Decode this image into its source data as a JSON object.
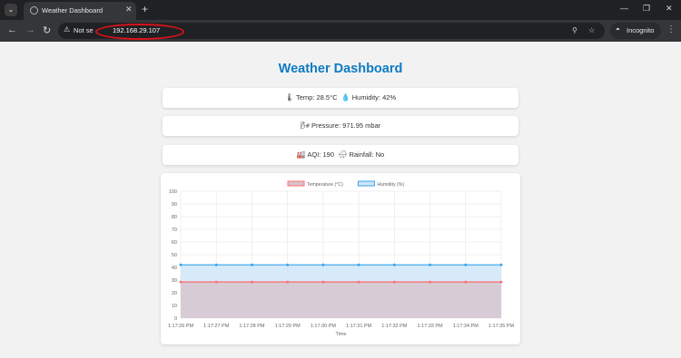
{
  "browser": {
    "tab_title": "Weather Dashboard",
    "omnibox": {
      "security_label": "Not se",
      "url": "192.168.29.107"
    },
    "incognito_label": "Incognito"
  },
  "dashboard": {
    "title": "Weather Dashboard",
    "temp_label": "Temp:",
    "temp_value": "28.5°C",
    "humidity_label": "Humidity:",
    "humidity_value": "42%",
    "pressure_label": "Pressure:",
    "pressure_value": "971.95 mbar",
    "aqi_label": "AQI:",
    "aqi_value": "190",
    "rainfall_label": "Rainfall:",
    "rainfall_value": "No"
  },
  "colors": {
    "title": "#0d7bc3",
    "temperature_line": "#ff6b6b",
    "temperature_fill": "#d7c5cf",
    "humidity_line": "#36a2eb",
    "humidity_fill": "#cfe6f8",
    "annotation": "#d9121b"
  },
  "icons": {
    "temp": "thermometer-icon",
    "humidity": "droplet-icon",
    "pressure": "pressure-gauge-icon",
    "aqi": "factory-icon",
    "rainfall": "rain-cloud-icon"
  },
  "chart_data": {
    "type": "line",
    "title": "",
    "xlabel": "Time",
    "ylabel": "",
    "ylim": [
      0,
      100
    ],
    "yticks": [
      0,
      10,
      20,
      30,
      40,
      50,
      60,
      70,
      80,
      90,
      100
    ],
    "categories": [
      "1:17:26 PM",
      "1:17:27 PM",
      "1:17:28 PM",
      "1:17:29 PM",
      "1:17:30 PM",
      "1:17:31 PM",
      "1:17:32 PM",
      "1:17:33 PM",
      "1:17:34 PM",
      "1:17:35 PM"
    ],
    "series": [
      {
        "name": "Temperature (°C)",
        "values": [
          28.5,
          28.5,
          28.5,
          28.5,
          28.5,
          28.5,
          28.5,
          28.5,
          28.5,
          28.5
        ]
      },
      {
        "name": "Humidity (%)",
        "values": [
          42,
          42,
          42,
          42,
          42,
          42,
          42,
          42,
          42,
          42
        ]
      }
    ],
    "grid": true,
    "legend": "top-center",
    "filled": true
  }
}
